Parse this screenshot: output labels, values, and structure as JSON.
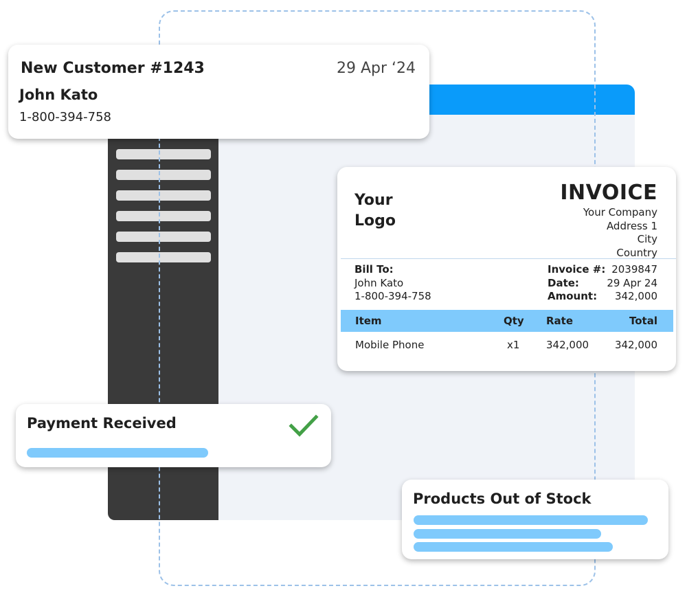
{
  "customer_card": {
    "title": "New Customer #1243",
    "date": "29 Apr ‘24",
    "name": "John Kato",
    "phone": "1-800-394-758"
  },
  "invoice": {
    "logo_line1": "Your",
    "logo_line2": "Logo",
    "title": "INVOICE",
    "company": [
      "Your Company",
      "Address 1",
      "City",
      "Country"
    ],
    "bill_to_label": "Bill To:",
    "bill_to_name": "John Kato",
    "bill_to_phone": "1-800-394-758",
    "meta": [
      {
        "label": "Invoice #:",
        "value": "2039847"
      },
      {
        "label": "Date:",
        "value": "29 Apr 24"
      },
      {
        "label": "Amount:",
        "value": "342,000"
      }
    ],
    "columns": [
      "Item",
      "Qty",
      "Rate",
      "Total"
    ],
    "rows": [
      {
        "item": "Mobile Phone",
        "qty": "x1",
        "rate": "342,000",
        "total": "342,000"
      }
    ]
  },
  "payment_card": {
    "title": "Payment Received",
    "status_icon": "check-icon",
    "progress_percent": 66
  },
  "stock_card": {
    "title": "Products Out of Stock",
    "bars_percent": [
      100,
      80,
      85
    ]
  },
  "sidebar": {
    "placeholder_item_count": 6
  },
  "colors": {
    "header_blue": "#0a9bfa",
    "accent_light_blue": "#7fcafc",
    "sidebar_dark": "#3a3a3a",
    "check_green": "#43a047",
    "dashed_outline": "#9cc1e8"
  }
}
